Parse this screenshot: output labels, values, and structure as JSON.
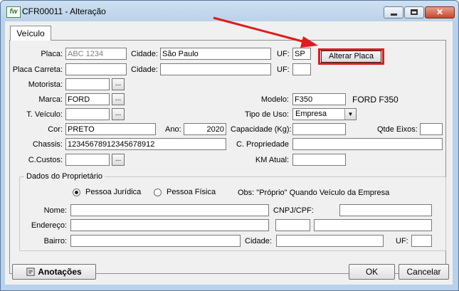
{
  "window": {
    "title": "CFR00011 - Alteração",
    "app_icon": "fw",
    "close_glyph": "✕"
  },
  "tabs": {
    "active": "Veículo"
  },
  "vehicle": {
    "placa_label": "Placa:",
    "placa_value": "ABC 1234",
    "cidade_label": "Cidade:",
    "cidade_value": "São Paulo",
    "uf_label": "UF:",
    "uf_value": "SP",
    "alterar_placa_label": "Alterar Placa",
    "placa_carreta_label": "Placa Carreta:",
    "placa_carreta_value": "",
    "cidade2_label": "Cidade:",
    "cidade2_value": "",
    "uf2_label": "UF:",
    "uf2_value": "",
    "motorista_label": "Motorista:",
    "motorista_value": "",
    "marca_label": "Marca:",
    "marca_value": "FORD",
    "modelo_label": "Modelo:",
    "modelo_value": "F350",
    "modelo_desc": "FORD F350",
    "tveiculo_label": "T. Veículo:",
    "tveiculo_value": "",
    "tipo_uso_label": "Tipo de Uso:",
    "tipo_uso_value": "Empresa",
    "cor_label": "Cor:",
    "cor_value": "PRETO",
    "ano_label": "Ano:",
    "ano_value": "2020",
    "capacidade_label": "Capacidade (Kg):",
    "capacidade_value": "",
    "qtde_eixos_label": "Qtde Eixos:",
    "qtde_eixos_value": "",
    "chassis_label": "Chassis:",
    "chassis_value": "12345678912345678912",
    "propriedade_label": "C. Propriedade",
    "propriedade_value": "",
    "ccustos_label": "C.Custos:",
    "ccustos_value": "",
    "km_label": "KM Atual:",
    "km_value": "",
    "dots": "..."
  },
  "owner": {
    "group_title": "Dados do Proprietário",
    "radio_juridica": "Pessoa Jurídica",
    "radio_fisica": "Pessoa Física",
    "obs": "Obs: \"Próprio\" Quando Veículo da Empresa",
    "nome_label": "Nome:",
    "nome_value": "",
    "cnpj_label": "CNPJ/CPF:",
    "cnpj_value": "",
    "endereco_label": "Endereço:",
    "endereco_value": "",
    "numero_value": "",
    "complemento_value": "",
    "bairro_label": "Bairro:",
    "bairro_value": "",
    "cidade_label": "Cidade:",
    "cidade_value": "",
    "uf_label": "UF:",
    "uf_value": ""
  },
  "buttons": {
    "anotacoes": "Anotações",
    "ok": "OK",
    "cancelar": "Cancelar"
  },
  "colors": {
    "annotation_red": "#e01b1b"
  }
}
